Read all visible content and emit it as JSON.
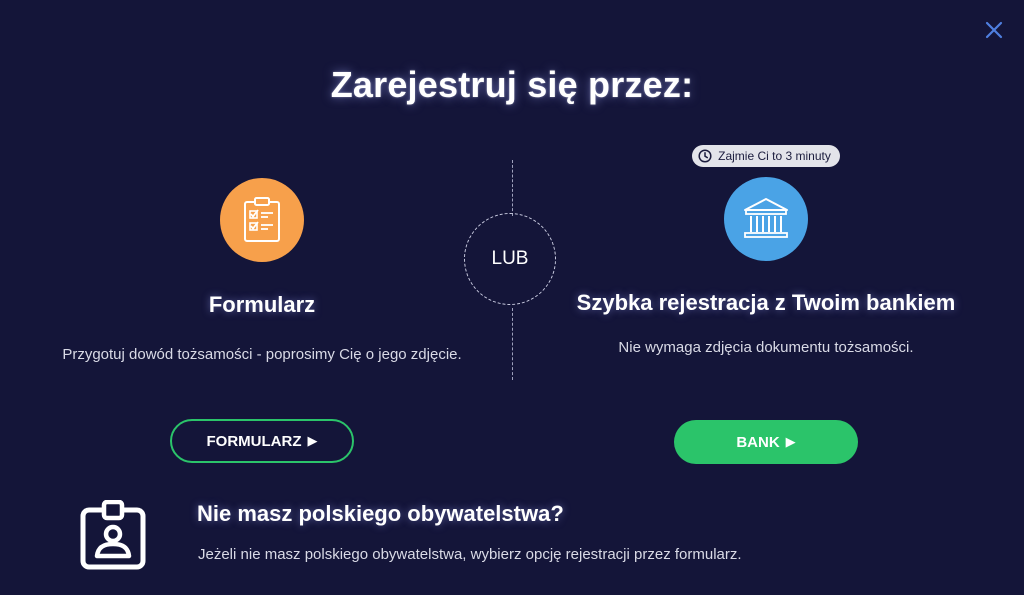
{
  "dialog": {
    "title": "Zarejestruj się przez:",
    "close_icon": "close-icon",
    "divider_label": "LUB"
  },
  "form_option": {
    "icon": "clipboard-checklist-icon",
    "title": "Formularz",
    "description": "Przygotuj dowód tożsamości - poprosimy Cię o jego zdjęcie.",
    "button_label": "FORMULARZ",
    "button_arrow": "▶"
  },
  "bank_option": {
    "badge_icon": "clock-icon",
    "badge_text": "Zajmie Ci to 3 minuty",
    "icon": "bank-building-icon",
    "title": "Szybka rejestracja z Twoim bankiem",
    "description": "Nie wymaga zdjęcia dokumentu tożsamości.",
    "button_label": "BANK",
    "button_arrow": "▶"
  },
  "citizenship_note": {
    "icon": "id-badge-icon",
    "title": "Nie masz polskiego obywatelstwa?",
    "description": "Jeżeli nie masz polskiego obywatelstwa, wybierz opcję rejestracji przez formularz."
  },
  "colors": {
    "background": "#141539",
    "accent_green": "#2bc46a",
    "orange": "#f7a04b",
    "blue": "#4aa3e6",
    "close_blue": "#4f7fe0"
  }
}
